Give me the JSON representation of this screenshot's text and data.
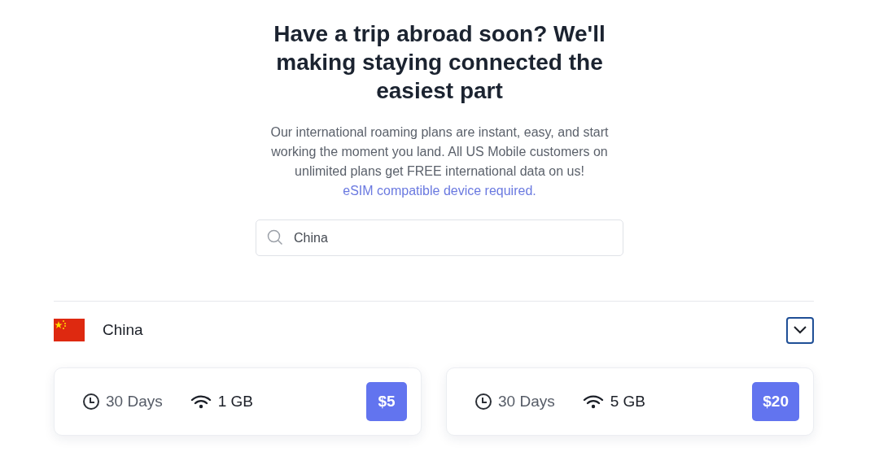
{
  "heading": "Have a trip abroad soon? We'll making staying connected the easiest part",
  "intro": {
    "text": "Our international roaming plans are instant, easy, and start working the moment you land. All US Mobile customers on unlimited plans get FREE international data on us!",
    "link": "eSIM compatible device required."
  },
  "search": {
    "value": "China"
  },
  "country": {
    "name": "China",
    "expanded": true,
    "plans": [
      {
        "duration": "30 Days",
        "data": "1 GB",
        "price": "$5"
      },
      {
        "duration": "30 Days",
        "data": "5 GB",
        "price": "$20"
      }
    ]
  }
}
